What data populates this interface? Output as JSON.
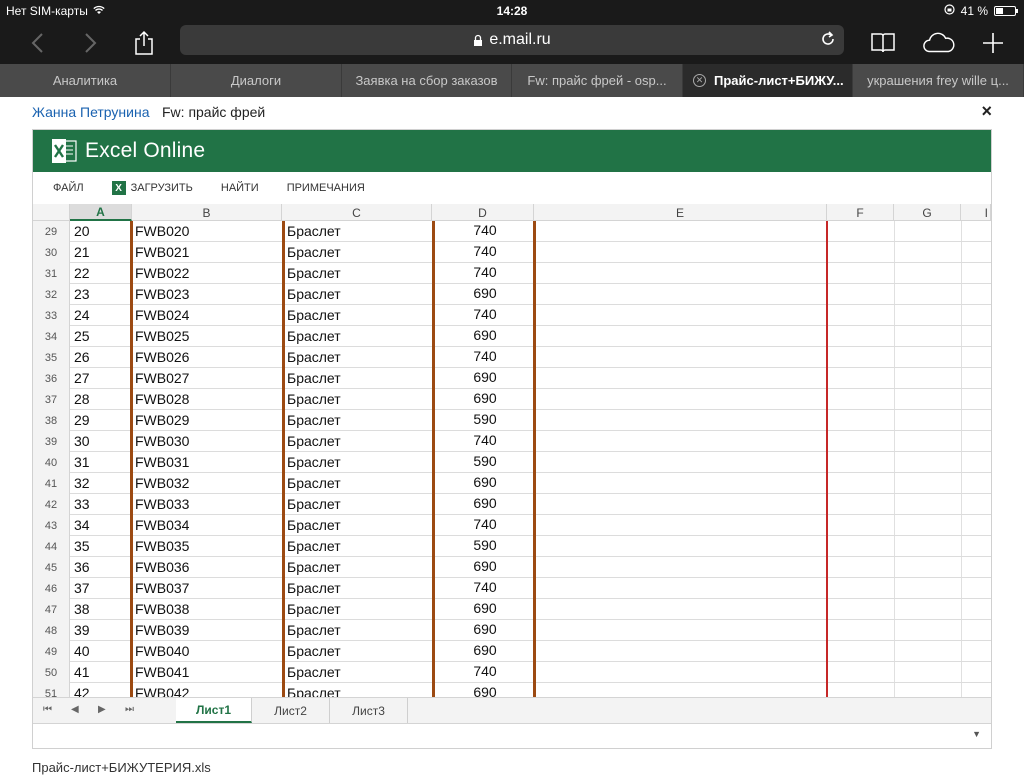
{
  "status": {
    "carrier": "Нет SIM-карты",
    "time": "14:28",
    "battery": "41 %",
    "battery_level": 0.41
  },
  "browser": {
    "url": "e.mail.ru",
    "tabs": [
      {
        "label": "Аналитика",
        "active": false
      },
      {
        "label": "Диалоги",
        "active": false
      },
      {
        "label": "Заявка на сбор заказов",
        "active": false
      },
      {
        "label": "Fw: прайс фрей - osp...",
        "active": false
      },
      {
        "label": "Прайс-лист+БИЖУ...",
        "active": true
      },
      {
        "label": "украшения frey wille ц...",
        "active": false
      }
    ]
  },
  "mail": {
    "sender": "Жанна Петрунина",
    "subject": "Fw: прайс фрей",
    "close": "×"
  },
  "excel": {
    "title": "Excel Online",
    "menu": {
      "file": "ФАЙЛ",
      "download": "ЗАГРУЗИТЬ",
      "find": "НАЙТИ",
      "notes": "ПРИМЕЧАНИЯ"
    },
    "columns": [
      "A",
      "B",
      "C",
      "D",
      "E",
      "F",
      "G",
      "I"
    ],
    "rows": [
      {
        "n": "29",
        "a": "20",
        "b": "FWB020",
        "c": "Браслет",
        "d": "740"
      },
      {
        "n": "30",
        "a": "21",
        "b": "FWB021",
        "c": "Браслет",
        "d": "740"
      },
      {
        "n": "31",
        "a": "22",
        "b": "FWB022",
        "c": "Браслет",
        "d": "740"
      },
      {
        "n": "32",
        "a": "23",
        "b": "FWB023",
        "c": "Браслет",
        "d": "690"
      },
      {
        "n": "33",
        "a": "24",
        "b": "FWB024",
        "c": "Браслет",
        "d": "740"
      },
      {
        "n": "34",
        "a": "25",
        "b": "FWB025",
        "c": "Браслет",
        "d": "690"
      },
      {
        "n": "35",
        "a": "26",
        "b": "FWB026",
        "c": "Браслет",
        "d": "740"
      },
      {
        "n": "36",
        "a": "27",
        "b": "FWB027",
        "c": "Браслет",
        "d": "690"
      },
      {
        "n": "37",
        "a": "28",
        "b": "FWB028",
        "c": "Браслет",
        "d": "690"
      },
      {
        "n": "38",
        "a": "29",
        "b": "FWB029",
        "c": "Браслет",
        "d": "590"
      },
      {
        "n": "39",
        "a": "30",
        "b": "FWB030",
        "c": "Браслет",
        "d": "740"
      },
      {
        "n": "40",
        "a": "31",
        "b": "FWB031",
        "c": "Браслет",
        "d": "590"
      },
      {
        "n": "41",
        "a": "32",
        "b": "FWB032",
        "c": "Браслет",
        "d": "690"
      },
      {
        "n": "42",
        "a": "33",
        "b": "FWB033",
        "c": "Браслет",
        "d": "690"
      },
      {
        "n": "43",
        "a": "34",
        "b": "FWB034",
        "c": "Браслет",
        "d": "740"
      },
      {
        "n": "44",
        "a": "35",
        "b": "FWB035",
        "c": "Браслет",
        "d": "590"
      },
      {
        "n": "45",
        "a": "36",
        "b": "FWB036",
        "c": "Браслет",
        "d": "690"
      },
      {
        "n": "46",
        "a": "37",
        "b": "FWB037",
        "c": "Браслет",
        "d": "740"
      },
      {
        "n": "47",
        "a": "38",
        "b": "FWB038",
        "c": "Браслет",
        "d": "690"
      },
      {
        "n": "48",
        "a": "39",
        "b": "FWB039",
        "c": "Браслет",
        "d": "690"
      },
      {
        "n": "49",
        "a": "40",
        "b": "FWB040",
        "c": "Браслет",
        "d": "690"
      },
      {
        "n": "50",
        "a": "41",
        "b": "FWB041",
        "c": "Браслет",
        "d": "740"
      },
      {
        "n": "51",
        "a": "42",
        "b": "FWB042",
        "c": "Браслет",
        "d": "690"
      }
    ],
    "sheets": [
      {
        "label": "Лист1",
        "active": true
      },
      {
        "label": "Лист2",
        "active": false
      },
      {
        "label": "Лист3",
        "active": false
      }
    ]
  },
  "footer": {
    "text": "Прайс-лист+БИЖУТЕРИЯ.xls"
  },
  "colors": {
    "excel_green": "#217346",
    "border_brown": "#9c4a12",
    "border_red": "#c62828",
    "link_blue": "#1a62b0"
  }
}
